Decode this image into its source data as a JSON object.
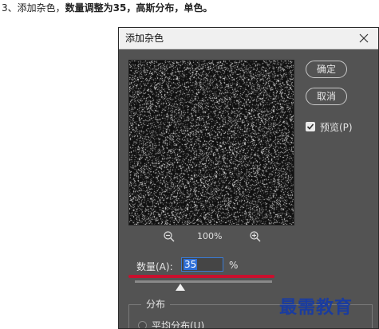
{
  "instruction": {
    "prefix": "3、添加杂色，",
    "bold": "数量调整为35，高斯分布，单色。"
  },
  "dialog": {
    "title": "添加杂色",
    "ok_label": "确定",
    "cancel_label": "取消",
    "preview_label": "预览(P)",
    "preview_checked": true,
    "zoom_level": "100%",
    "amount_label": "数量(A):",
    "amount_value": "35",
    "amount_unit": "%",
    "distribution_title": "分布",
    "distribution_uniform_label": "平均分布(U)"
  },
  "watermark": "最需教育",
  "icons": {
    "close": "close-icon",
    "zoom_out": "zoom-out-icon",
    "zoom_in": "zoom-in-icon",
    "check": "checkmark-icon"
  },
  "colors": {
    "dialog_bg": "#535353",
    "accent_blue": "#2f6fd6",
    "highlight_red": "#c8102e",
    "watermark_blue": "#1a3ca0"
  }
}
